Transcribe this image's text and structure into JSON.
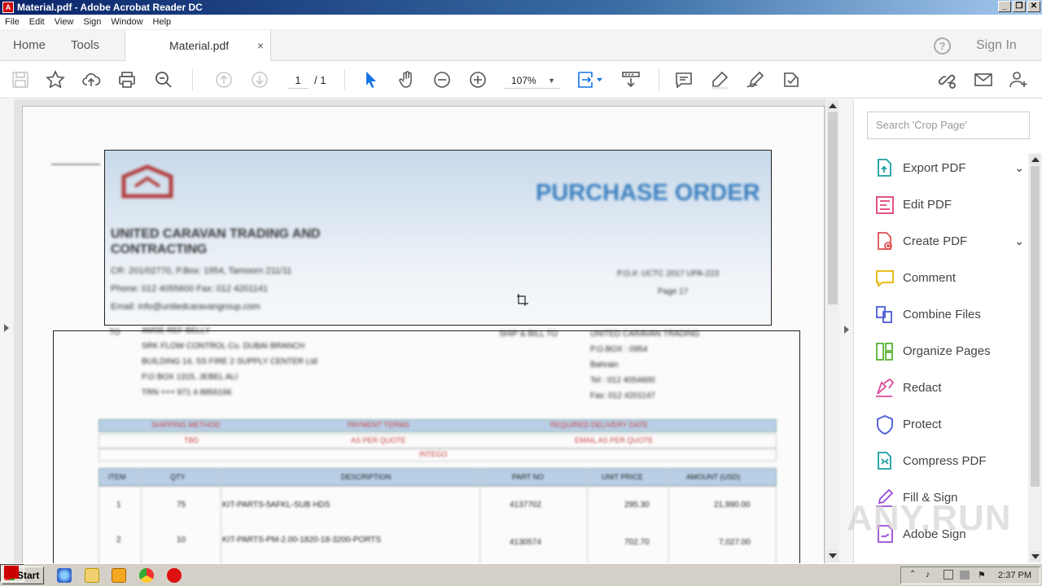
{
  "window": {
    "title": "Material.pdf - Adobe Acrobat Reader DC",
    "controls": [
      "_",
      "❐",
      "✕"
    ]
  },
  "menu": [
    "File",
    "Edit",
    "View",
    "Sign",
    "Window",
    "Help"
  ],
  "tabs": {
    "home": "Home",
    "tools": "Tools",
    "document": "Material.pdf",
    "close_glyph": "×",
    "help_glyph": "?",
    "sign_in": "Sign In"
  },
  "toolbar": {
    "page_current": "1",
    "page_total": "/ 1",
    "zoom": "107%",
    "zoom_caret": "▼"
  },
  "document": {
    "heading": "PURCHASE ORDER",
    "company_line1": "UNITED CARAVAN TRADING AND",
    "company_line2": "CONTRACTING",
    "address_line1": "CR: 201/02770, P.Box: 1954, Tamoorn 211/11",
    "address_line2": "Phone: 012 4055600 Fax: 012 4201141",
    "address_line3": "Email: info@unitedcaravangroup.com",
    "ref_line1": "P.O.#: UCTC 2017 UPA-223",
    "ref_line2": "Page 17",
    "to_block": [
      "AMSE REF BELLY",
      "SRK FLOW CONTROL Co. DUBAI BRANCH",
      "BUILDING 14, SS FIRE 2 SUPPLY CENTER Ltd",
      "P.O BOX 1315, JEBEL ALI",
      "TRN  +++ 971 4 8856166"
    ],
    "shipto_label": "SHIP & BILL TO",
    "shipto_block": [
      "UNITED CARAVAN TRADING",
      "P.O.BOX : 0954",
      "Bahrain",
      "Tel : 012 4054600",
      "Fax: 012 4201147"
    ],
    "terms_headers": [
      "SHIPPING METHOD",
      "PAYMENT TERMS",
      "REQUIRED DELIVERY DATE"
    ],
    "terms_values": [
      "TBD",
      "AS PER QUOTE",
      "EMAIL AS PER QUOTE"
    ],
    "terms_note": "INTEGO",
    "table_headers": [
      "ITEM",
      "QTY",
      "DESCRIPTION",
      "PART NO",
      "UNIT PRICE",
      "AMOUNT (USD)"
    ],
    "table_rows": [
      [
        "1",
        "75",
        "KIT-PARTS-5AFKL-SUB HDS",
        "4137702",
        "295.30",
        "21,990.00"
      ],
      [
        "2",
        "10",
        "KIT-PARTS-PM-2.00-1820-18-3200-PORTS",
        "4130574",
        "702.70",
        "7,027.00"
      ]
    ]
  },
  "right_pane": {
    "search_placeholder": "Search 'Crop Page'",
    "tools": [
      {
        "label": "Export PDF",
        "chevron": "⌄",
        "color": "#1a9fa0"
      },
      {
        "label": "Edit PDF",
        "chevron": "",
        "color": "#e0427a"
      },
      {
        "label": "Create PDF",
        "chevron": "⌄",
        "color": "#e05050"
      },
      {
        "label": "Comment",
        "chevron": "",
        "color": "#e8b400"
      },
      {
        "label": "Combine Files",
        "chevron": "",
        "color": "#4a5bd6"
      },
      {
        "label": "Organize Pages",
        "chevron": "",
        "color": "#5ab235"
      },
      {
        "label": "Redact",
        "chevron": "",
        "color": "#d84a9a"
      },
      {
        "label": "Protect",
        "chevron": "",
        "color": "#4a5bd6"
      },
      {
        "label": "Compress PDF",
        "chevron": "",
        "color": "#1a9fa0"
      },
      {
        "label": "Fill & Sign",
        "chevron": "",
        "color": "#9a4ad6"
      },
      {
        "label": "Adobe Sign",
        "chevron": "",
        "color": "#9a4ad6"
      }
    ]
  },
  "watermark": "ANY.RUN",
  "taskbar": {
    "start": "Start",
    "clock": "2:37 PM"
  }
}
